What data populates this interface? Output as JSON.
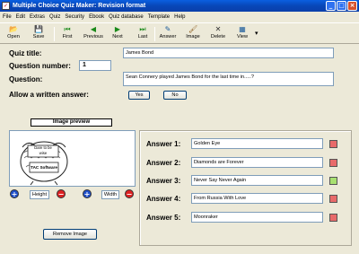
{
  "window": {
    "title": "Multiple Choice Quiz Maker: Revision format",
    "minimize_glyph": "_",
    "maximize_glyph": "□",
    "close_glyph": "×"
  },
  "menu": [
    "File",
    "Edit",
    "Extras",
    "Quiz",
    "Security",
    "Ebook",
    "Quiz database",
    "Template",
    "Help"
  ],
  "toolbar": [
    {
      "label": "Open",
      "icon": "folder-icon",
      "glyph": "📂",
      "color": "#C9A227"
    },
    {
      "label": "Save",
      "icon": "floppy-icon",
      "glyph": "💾",
      "color": "#333"
    },
    {
      "label": "First",
      "icon": "first-icon",
      "glyph": "⏮",
      "color": "#1A8A1A"
    },
    {
      "label": "Previous",
      "icon": "previous-icon",
      "glyph": "◀",
      "color": "#1A8A1A"
    },
    {
      "label": "Next",
      "icon": "next-icon",
      "glyph": "▶",
      "color": "#1A8A1A"
    },
    {
      "label": "Last",
      "icon": "last-icon",
      "glyph": "⏭",
      "color": "#1A8A1A"
    },
    {
      "label": "Answer",
      "icon": "answer-icon",
      "glyph": "✎",
      "color": "#1A5A9A"
    },
    {
      "label": "Image",
      "icon": "image-icon",
      "glyph": "🖌",
      "color": "#8A5A1A"
    },
    {
      "label": "Delete",
      "icon": "delete-icon",
      "glyph": "✕",
      "color": "#333"
    },
    {
      "label": "View",
      "icon": "view-icon",
      "glyph": "▦",
      "color": "#1A5A9A"
    }
  ],
  "view_dropdown_glyph": "▾",
  "form": {
    "quiz_title_label": "Quiz title:",
    "quiz_title_value": "James Bond",
    "question_number_label": "Question number:",
    "question_number_value": "1",
    "question_label": "Question:",
    "question_value": "Sean Connery played James Bond for the last time in.....?",
    "written_answer_label": "Allow a written answer:",
    "yes_label": "Yes",
    "no_label": "No"
  },
  "image_preview": {
    "header": "Image preview",
    "sign_text": "Dare to be wise",
    "logo_text": "TAC Software",
    "plus_glyph": "+",
    "minus_glyph": "−",
    "height_label": "Height",
    "width_label": "Width",
    "remove_label": "Remove Image"
  },
  "answers": [
    {
      "label": "Answer 1:",
      "value": "Golden Eye",
      "correct": false
    },
    {
      "label": "Answer 2:",
      "value": "Diamonds are Forever",
      "correct": false
    },
    {
      "label": "Answer 3:",
      "value": "Never Say Never Again",
      "correct": true
    },
    {
      "label": "Answer 4:",
      "value": "From Russia With Love",
      "correct": false
    },
    {
      "label": "Answer 5:",
      "value": "Moonraker",
      "correct": false
    }
  ],
  "colors": {
    "titlebar": "#0A5FE0",
    "window_bg": "#ECE9D8",
    "correct": "#A8E070",
    "incorrect": "#E86A6A"
  }
}
